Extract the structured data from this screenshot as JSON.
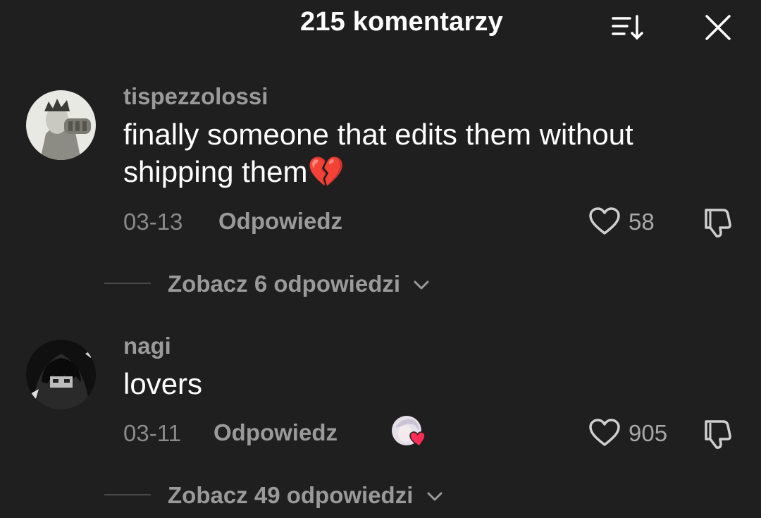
{
  "header": {
    "title": "215 komentarzy",
    "icons": [
      "sort-icon",
      "close-icon"
    ]
  },
  "comments": [
    {
      "username": "tispezzolossi",
      "text": "finally someone that edits them without shipping them💔",
      "date": "03-13",
      "reply_label": "Odpowiedz",
      "likes": "58",
      "view_replies": "Zobacz 6 odpowiedzi",
      "creator_liked": false
    },
    {
      "username": "nagi",
      "text": "lovers",
      "date": "03-11",
      "reply_label": "Odpowiedz",
      "likes": "905",
      "view_replies": "Zobacz 49 odpowiedzi",
      "creator_liked": true
    }
  ],
  "colors": {
    "background": "#1f1f1f",
    "username": "#9a9a9a",
    "text": "#ffffff",
    "muted": "#8a8a8a",
    "heart_badge": "#ff2d55"
  }
}
